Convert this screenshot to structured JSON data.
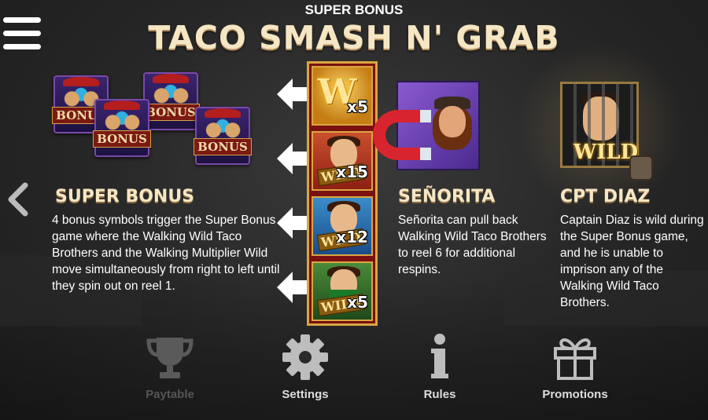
{
  "header": {
    "super_label": "SUPER BONUS",
    "title": "TACO SMASH N' GRAB"
  },
  "symbols": {
    "bonus_word": "BONUS",
    "reel": [
      {
        "icon": "multiplier-w-icon",
        "label": "W",
        "multiplier": "x5"
      },
      {
        "icon": "taco-brother-wild-icon",
        "label": "WILD",
        "multiplier": "x15"
      },
      {
        "icon": "taco-brother-wild-icon",
        "label": "WILD",
        "multiplier": "x12"
      },
      {
        "icon": "taco-brother-wild-icon",
        "label": "WILD",
        "multiplier": "x5"
      }
    ],
    "captain_wild": "WILD"
  },
  "sections": {
    "super_bonus": {
      "heading": "SUPER BONUS",
      "body": "4 bonus symbols trigger the Super Bonus game where the Walking Wild Taco Brothers and the Walking Multiplier Wild move simultaneously from right to left until they spin out on reel 1."
    },
    "senorita": {
      "heading": "SEÑORITA",
      "body": "Señorita can pull back Walking Wild Taco Brothers to reel 6 for additional respins."
    },
    "captain": {
      "heading": "CPT DIAZ",
      "body": "Captain Diaz is wild during the Super Bonus game, and he is unable to imprison any of the Walking Wild Taco Brothers."
    }
  },
  "nav": {
    "paytable": "Paytable",
    "settings": "Settings",
    "rules": "Rules",
    "promotions": "Promotions"
  },
  "colors": {
    "title": "#f5e6c4",
    "background": "#262626",
    "reel_frame": "#d8a640",
    "disabled_nav": "#555555"
  }
}
